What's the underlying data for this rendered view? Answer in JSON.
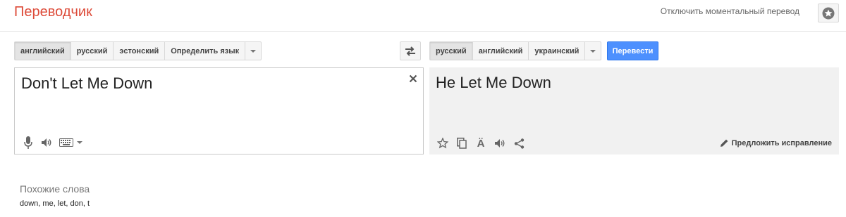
{
  "header": {
    "app_title": "Переводчик",
    "instant_toggle_label": "Отключить моментальный перевод",
    "star_icon": "star-icon"
  },
  "source": {
    "languages": [
      "английский",
      "русский",
      "эстонский",
      "Определить язык"
    ],
    "active_index": 0,
    "text": "Don't Let Me Down",
    "clear_label": "×",
    "tool_icons": [
      "microphone-icon",
      "speaker-icon",
      "keyboard-icon",
      "chevron-down-icon"
    ]
  },
  "swap_icon": "swap-icon",
  "target": {
    "languages": [
      "русский",
      "английский",
      "украинский"
    ],
    "active_index": 0,
    "translate_label": "Перевести",
    "text": "Не Let Me Down",
    "tool_icons": [
      "star-outline-icon",
      "copy-icon",
      "font-size-icon",
      "speaker-icon",
      "share-icon"
    ],
    "suggest_label": "Предложить исправление"
  },
  "similar": {
    "title": "Похожие слова",
    "words": "down, me, let, don, t"
  },
  "colors": {
    "brand_red": "#dd4b39",
    "button_blue": "#4d90fe",
    "output_bg": "#f1f1f1"
  }
}
